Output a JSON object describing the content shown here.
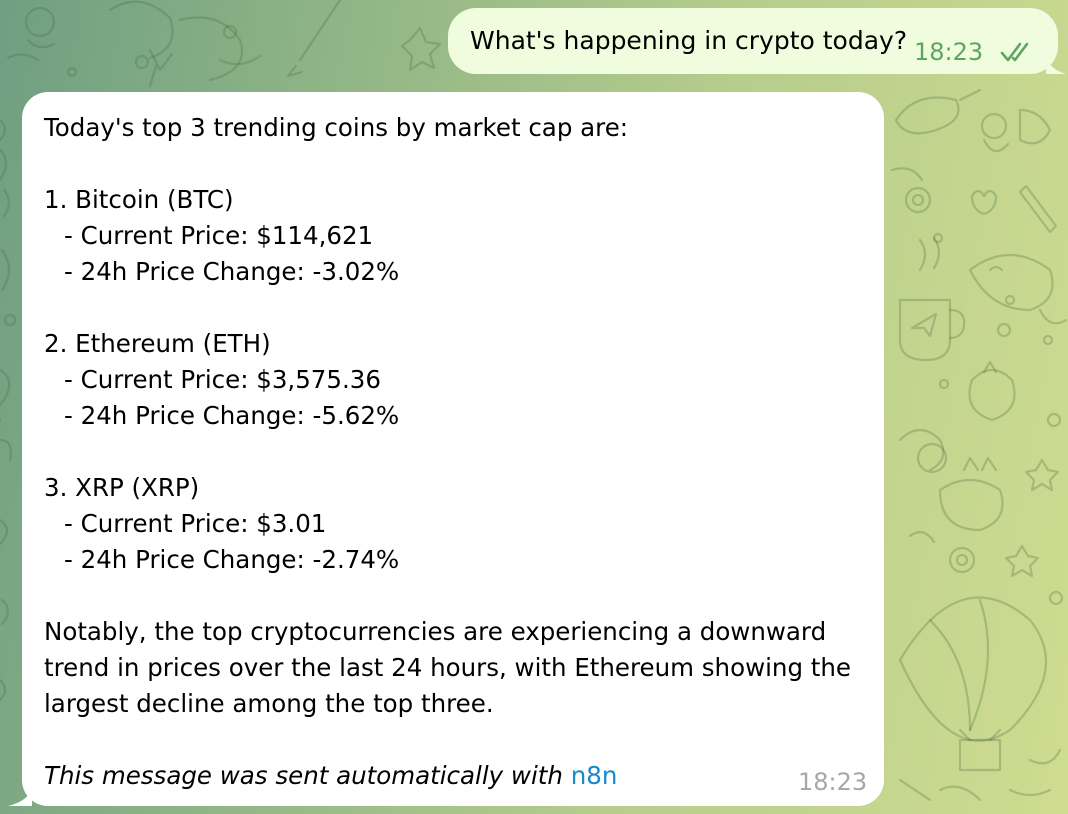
{
  "outgoing": {
    "text": "What's happening in crypto today?",
    "time": "18:23",
    "status_icon": "double-check-icon"
  },
  "incoming": {
    "intro": "Today's top 3 trending coins by market cap are:",
    "coins": [
      {
        "heading": "1. Bitcoin (BTC)",
        "price": "- Current Price: $114,621",
        "change": "- 24h Price Change: -3.02%"
      },
      {
        "heading": "2. Ethereum (ETH)",
        "price": "- Current Price: $3,575.36",
        "change": "- 24h Price Change: -5.62%"
      },
      {
        "heading": "3. XRP (XRP)",
        "price": "- Current Price: $3.01",
        "change": "- 24h Price Change: -2.74%"
      }
    ],
    "summary_lines": [
      "Notably, the top cryptocurrencies are experiencing a downward",
      "trend in prices over the last 24 hours, with Ethereum showing the",
      "largest decline among the top three."
    ],
    "footer_text": "This message was sent automatically with",
    "footer_link": "n8n",
    "time": "18:23"
  },
  "colors": {
    "outgoing_bubble": "#effdde",
    "incoming_bubble": "#ffffff",
    "outgoing_meta": "#5ea55f",
    "incoming_meta": "#a3a8ac",
    "link": "#168acd"
  }
}
